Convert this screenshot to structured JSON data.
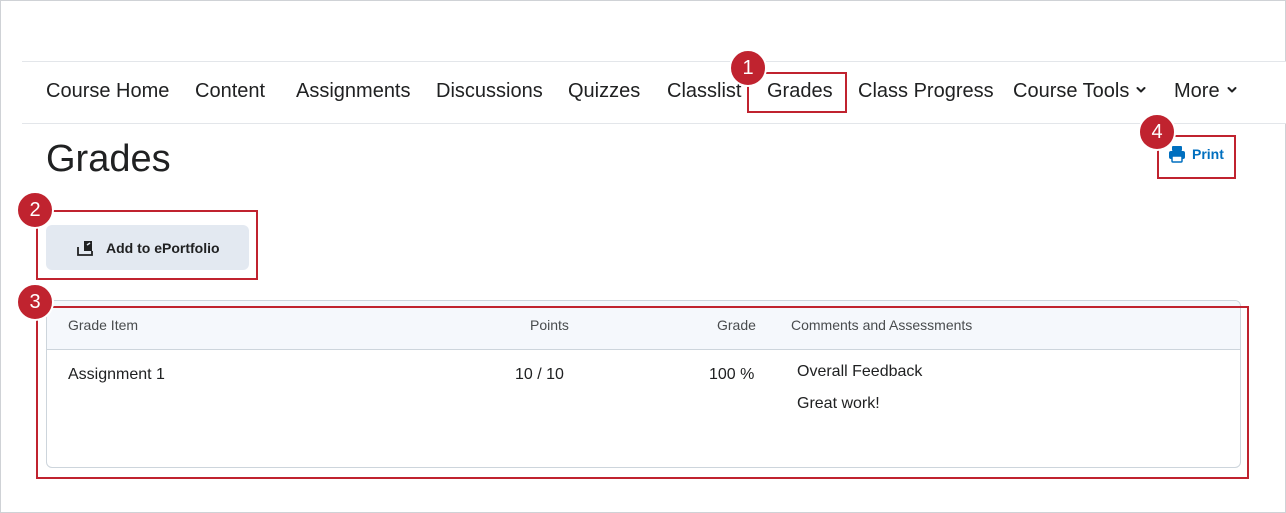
{
  "nav": {
    "items": [
      {
        "label": "Course Home"
      },
      {
        "label": "Content"
      },
      {
        "label": "Assignments"
      },
      {
        "label": "Discussions"
      },
      {
        "label": "Quizzes"
      },
      {
        "label": "Classlist"
      },
      {
        "label": "Grades"
      },
      {
        "label": "Class Progress"
      },
      {
        "label": "Course Tools",
        "icon": "chevron-down-icon"
      },
      {
        "label": "More",
        "icon": "chevron-down-icon"
      }
    ]
  },
  "page": {
    "title": "Grades",
    "print_label": "Print",
    "print_icon": "printer-icon",
    "eportfolio_label": "Add to ePortfolio",
    "eportfolio_icon": "eportfolio-icon"
  },
  "table": {
    "headers": {
      "item": "Grade Item",
      "points": "Points",
      "grade": "Grade",
      "comments": "Comments and Assessments"
    },
    "rows": [
      {
        "item": "Assignment 1",
        "points": "10 / 10",
        "grade": "100 %",
        "feedback_title": "Overall Feedback",
        "feedback_text": "Great work!"
      }
    ]
  },
  "callouts": [
    "1",
    "2",
    "3",
    "4"
  ],
  "colors": {
    "callout": "#c0232f",
    "link": "#006fbf",
    "button_bg": "#e3e9f1",
    "header_bg": "#f5f8fc"
  }
}
